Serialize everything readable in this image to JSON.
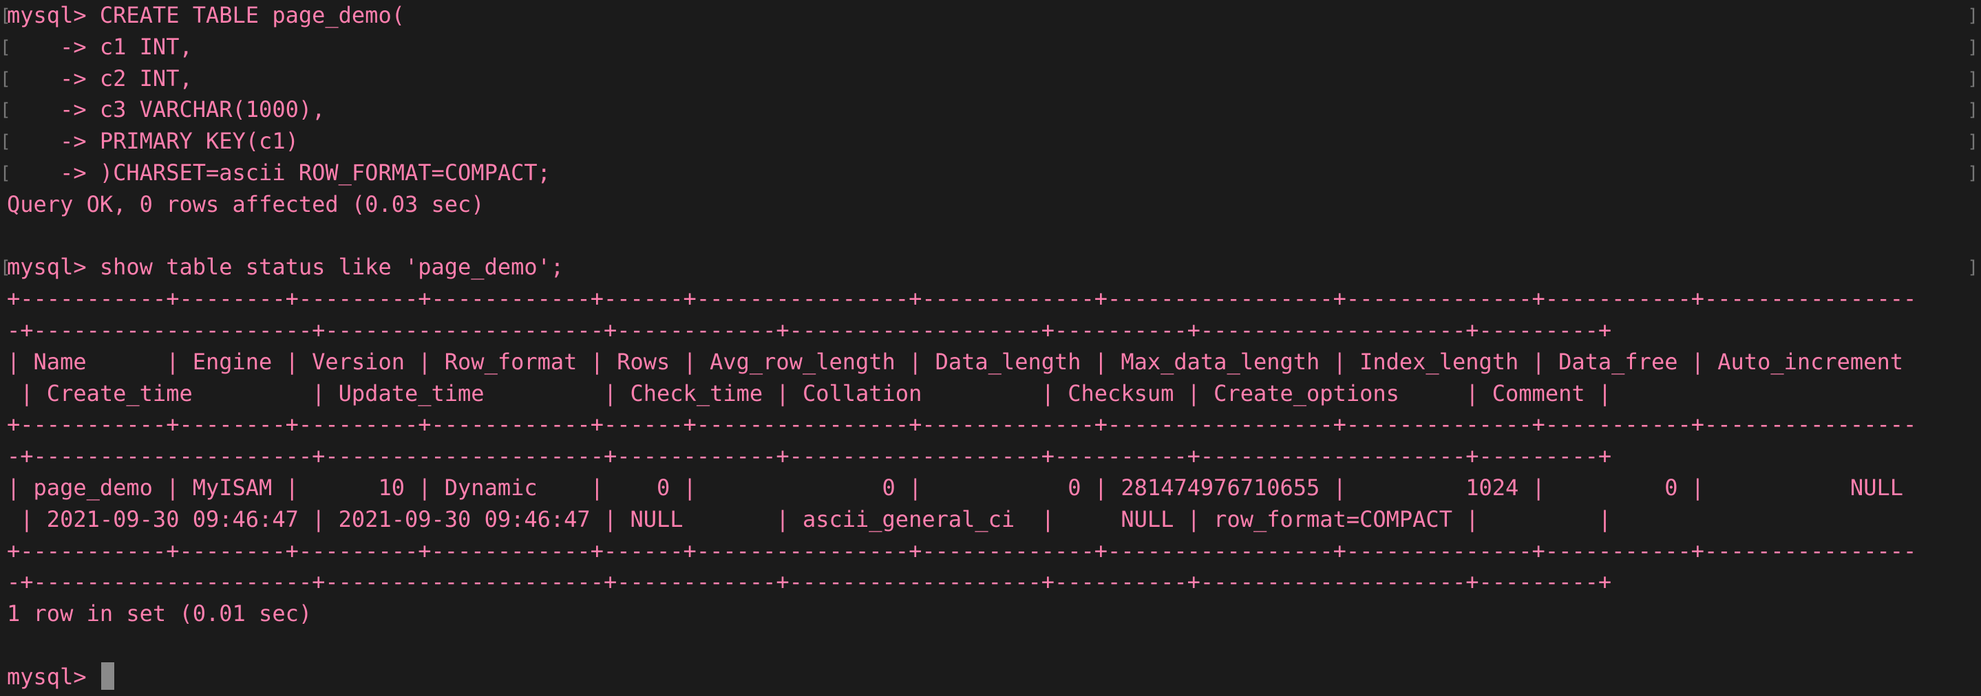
{
  "terminal": {
    "colors": {
      "background": "#1b1b1b",
      "text": "#ff7fae",
      "cursor": "#8a8a8a",
      "bracket": "#777777"
    },
    "lines": [
      "mysql> CREATE TABLE page_demo(",
      "    -> c1 INT,",
      "    -> c2 INT,",
      "    -> c3 VARCHAR(1000),",
      "    -> PRIMARY KEY(c1)",
      "    -> )CHARSET=ascii ROW_FORMAT=COMPACT;",
      "Query OK, 0 rows affected (0.03 sec)",
      "",
      "mysql> show table status like 'page_demo';",
      "+-----------+--------+---------+------------+------+----------------+-------------+-----------------+--------------+-----------+----------------",
      "-+---------------------+---------------------+------------+-------------------+----------+--------------------+---------+",
      "| Name      | Engine | Version | Row_format | Rows | Avg_row_length | Data_length | Max_data_length | Index_length | Data_free | Auto_increment",
      " | Create_time         | Update_time         | Check_time | Collation         | Checksum | Create_options     | Comment |",
      "+-----------+--------+---------+------------+------+----------------+-------------+-----------------+--------------+-----------+----------------",
      "-+---------------------+---------------------+------------+-------------------+----------+--------------------+---------+",
      "| page_demo | MyISAM |      10 | Dynamic    |    0 |              0 |           0 | 281474976710655 |         1024 |         0 |           NULL",
      " | 2021-09-30 09:46:47 | 2021-09-30 09:46:47 | NULL       | ascii_general_ci  |     NULL | row_format=COMPACT |         |",
      "+-----------+--------+---------+------------+------+----------------+-------------+-----------------+--------------+-----------+----------------",
      "-+---------------------+---------------------+------------+-------------------+----------+--------------------+---------+",
      "1 row in set (0.01 sec)",
      "",
      "mysql> "
    ]
  }
}
